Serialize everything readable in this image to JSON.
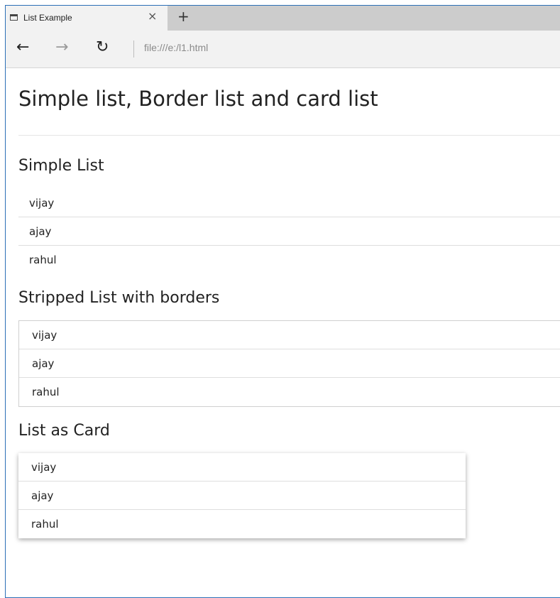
{
  "browser": {
    "tab_title": "List Example",
    "tab_close_glyph": "×",
    "new_tab_glyph": "+",
    "back_glyph": "←",
    "forward_glyph": "→",
    "reload_glyph": "↻",
    "address": "file:///e:/l1.html"
  },
  "page": {
    "title": "Simple list, Border list and card list",
    "sections": [
      {
        "heading": "Simple List",
        "items": [
          "vijay",
          "ajay",
          "rahul"
        ]
      },
      {
        "heading": "Stripped List with borders",
        "items": [
          "vijay",
          "ajay",
          "rahul"
        ]
      },
      {
        "heading": "List as Card",
        "items": [
          "vijay",
          "ajay",
          "rahul"
        ]
      }
    ]
  },
  "colors": {
    "window_border": "#2b6fb6",
    "tabstrip": "#cccccc",
    "chrome": "#f2f2f2"
  }
}
